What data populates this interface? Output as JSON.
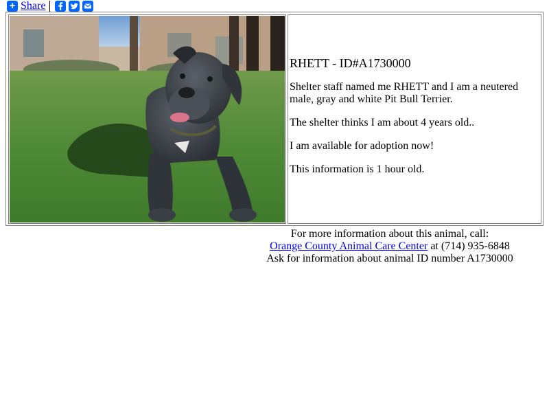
{
  "share": {
    "label": "Share",
    "icons": [
      "plus-icon",
      "facebook-icon",
      "twitter-icon",
      "email-icon"
    ],
    "accent": "#0166ff"
  },
  "animal": {
    "title": "RHETT - ID#A1730000",
    "desc1": "Shelter staff named me RHETT and I am a neutered male, gray and white Pit Bull Terrier.",
    "desc2": "The shelter thinks I am about 4 years old..",
    "desc3": "I am available for adoption now!",
    "desc4": "This information is 1 hour old."
  },
  "contact": {
    "line1": "For more information about this animal, call:",
    "shelter_link": "Orange County Animal Care Center",
    "phone_text": " at (714) 935-6848",
    "line3": "Ask for information about animal ID number A1730000"
  },
  "colors": {
    "link": "#0000ee",
    "border": "#808080"
  }
}
